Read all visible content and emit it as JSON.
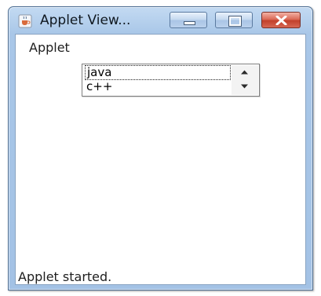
{
  "window": {
    "title": "Applet View...",
    "icon": "java-coffee-cup-icon",
    "controls": {
      "minimize": "minimize-icon",
      "maximize": "maximize-icon",
      "close": "close-icon"
    }
  },
  "applet": {
    "menu_label": "Applet",
    "list": {
      "items": [
        "java",
        "c++"
      ],
      "selected": "java"
    },
    "status": "Applet started."
  },
  "colors": {
    "close_button": "#c2402b",
    "frame": "#a9c7e8",
    "watermark": "#e5646c"
  }
}
